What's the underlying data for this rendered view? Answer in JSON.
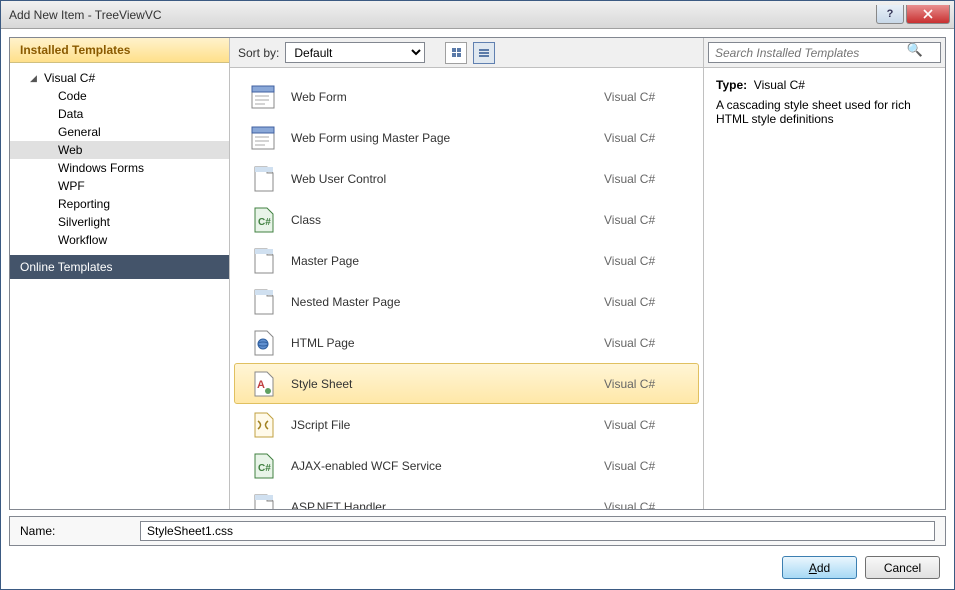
{
  "window": {
    "title": "Add New Item - TreeViewVC"
  },
  "sidebar": {
    "installed_header": "Installed Templates",
    "online_header": "Online Templates",
    "root": "Visual C#",
    "children": [
      "Code",
      "Data",
      "General",
      "Web",
      "Windows Forms",
      "WPF",
      "Reporting",
      "Silverlight",
      "Workflow"
    ],
    "selected_index": 3
  },
  "toolbar": {
    "sort_label": "Sort by:",
    "sort_value": "Default"
  },
  "search": {
    "placeholder": "Search Installed Templates"
  },
  "items": [
    {
      "name": "Web Form",
      "category": "Visual C#",
      "icon": "form"
    },
    {
      "name": "Web Form using Master Page",
      "category": "Visual C#",
      "icon": "form"
    },
    {
      "name": "Web User Control",
      "category": "Visual C#",
      "icon": "page"
    },
    {
      "name": "Class",
      "category": "Visual C#",
      "icon": "cs"
    },
    {
      "name": "Master Page",
      "category": "Visual C#",
      "icon": "page"
    },
    {
      "name": "Nested Master Page",
      "category": "Visual C#",
      "icon": "page"
    },
    {
      "name": "HTML Page",
      "category": "Visual C#",
      "icon": "html"
    },
    {
      "name": "Style Sheet",
      "category": "Visual C#",
      "icon": "css"
    },
    {
      "name": "JScript File",
      "category": "Visual C#",
      "icon": "js"
    },
    {
      "name": "AJAX-enabled WCF Service",
      "category": "Visual C#",
      "icon": "cs"
    },
    {
      "name": "ASP.NET Handler",
      "category": "Visual C#",
      "icon": "page"
    }
  ],
  "selected_item_index": 7,
  "detail": {
    "type_label": "Type:",
    "type_value": "Visual C#",
    "description": "A cascading style sheet used for rich HTML style definitions"
  },
  "name_field": {
    "label": "Name:",
    "value": "StyleSheet1.css"
  },
  "buttons": {
    "add": "Add",
    "cancel": "Cancel"
  }
}
